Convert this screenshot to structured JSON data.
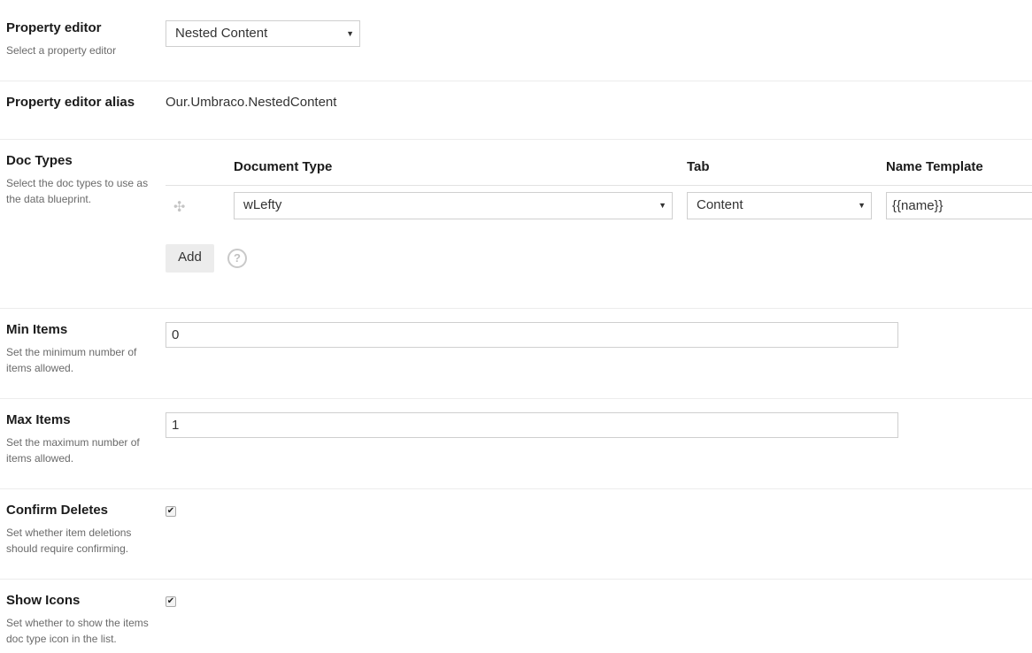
{
  "property_editor": {
    "label": "Property editor",
    "description": "Select a property editor",
    "selected": "Nested Content"
  },
  "property_editor_alias": {
    "label": "Property editor alias",
    "value": "Our.Umbraco.NestedContent"
  },
  "doc_types": {
    "label": "Doc Types",
    "description": "Select the doc types to use as the data blueprint.",
    "columns": [
      "Document Type",
      "Tab",
      "Name Template"
    ],
    "rows": [
      {
        "document_type": "wLefty",
        "tab": "Content",
        "name_template": "{{name}}"
      }
    ],
    "add_label": "Add",
    "help_glyph": "?"
  },
  "min_items": {
    "label": "Min Items",
    "description": "Set the minimum number of items allowed.",
    "value": "0"
  },
  "max_items": {
    "label": "Max Items",
    "description": "Set the maximum number of items allowed.",
    "value": "1"
  },
  "confirm_deletes": {
    "label": "Confirm Deletes",
    "description": "Set whether item deletions should require confirming.",
    "checked": true
  },
  "show_icons": {
    "label": "Show Icons",
    "description": "Set whether to show the items doc type icon in the list.",
    "checked": true
  },
  "icons": {
    "dropdown": "chevron-down-icon",
    "drag": "drag-handle-icon",
    "help": "question-circle-icon",
    "check": "checkmark-icon"
  }
}
